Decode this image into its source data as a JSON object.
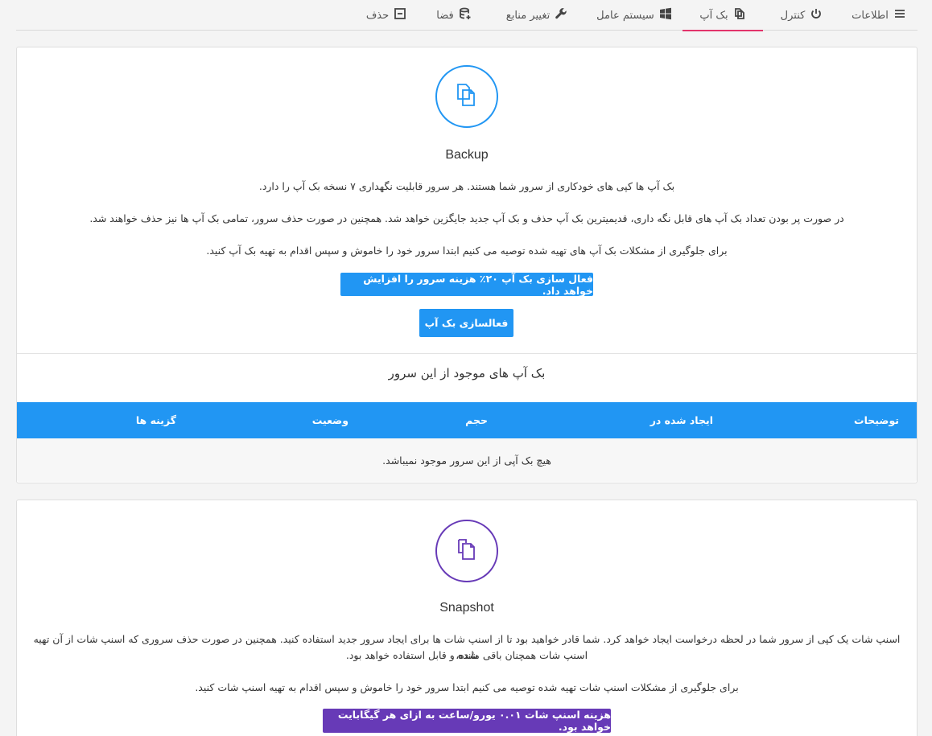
{
  "tabs": [
    {
      "label": "اطلاعات",
      "icon": "menu-icon"
    },
    {
      "label": "کنترل",
      "icon": "power-icon"
    },
    {
      "label": "بک آپ",
      "icon": "copy-icon",
      "active": true
    },
    {
      "label": "سیستم عامل",
      "icon": "windows-icon"
    },
    {
      "label": "تغییر منابع",
      "icon": "wrench-icon"
    },
    {
      "label": "فضا",
      "icon": "database-icon"
    },
    {
      "label": "حذف",
      "icon": "minus-box-icon"
    }
  ],
  "backup": {
    "title": "Backup",
    "p1": "بک آپ ها کپی های خودکاری از سرور شما هستند. هر سرور قابلیت نگهداری ۷ نسخه بک آپ را دارد.",
    "p2": "در صورت پر بودن تعداد بک آپ های قابل نگه داری، قدیمیترین بک آپ حذف و بک آپ جدید جایگزین خواهد شد. همچنین در صورت حذف سرور، تمامی بک آپ ها نیز حذف خواهند شد.",
    "p3": "برای جلوگیری از مشکلات بک آپ های تهیه شده توصیه می کنیم ابتدا سرور خود را خاموش و سپس اقدام به تهیه بک آپ کنید.",
    "notice": "فعال سازی بک آپ ۲۰٪ هزینه سرور را افزایش خواهد داد.",
    "activate_button": "فعالسازی بک آپ",
    "list_title": "بک آپ های موجود از این سرور",
    "columns": [
      "توضیحات",
      "ایجاد شده در",
      "حجم",
      "وضعیت",
      "گزینه ها"
    ],
    "empty": "هیچ بک آپی از این سرور موجود نمیباشد.",
    "accent": "#2196f3"
  },
  "snapshot": {
    "title": "Snapshot",
    "p1_line1": "اسنپ شات یک کپی از سرور شما در لحظه درخواست ایجاد خواهد کرد. شما قادر خواهید بود تا از اسنپ شات ها برای ایجاد سرور جدید استفاده کنید. همچنین در صورت حذف سروری که اسنپ شات از آن تهیه شده،",
    "p1_line2": "اسنپ شات همچنان باقی مانده و قابل استفاده خواهد بود.",
    "p2": "برای جلوگیری از مشکلات اسنپ شات تهیه شده توصیه می کنیم ابتدا سرور خود را خاموش و سپس اقدام به تهیه اسنپ شات کنید.",
    "notice": "هزینه اسنپ شات ۰.۰۱ یورو/ساعت به ازای هر گیگابایت خواهد بود.",
    "accent": "#673ab7"
  }
}
